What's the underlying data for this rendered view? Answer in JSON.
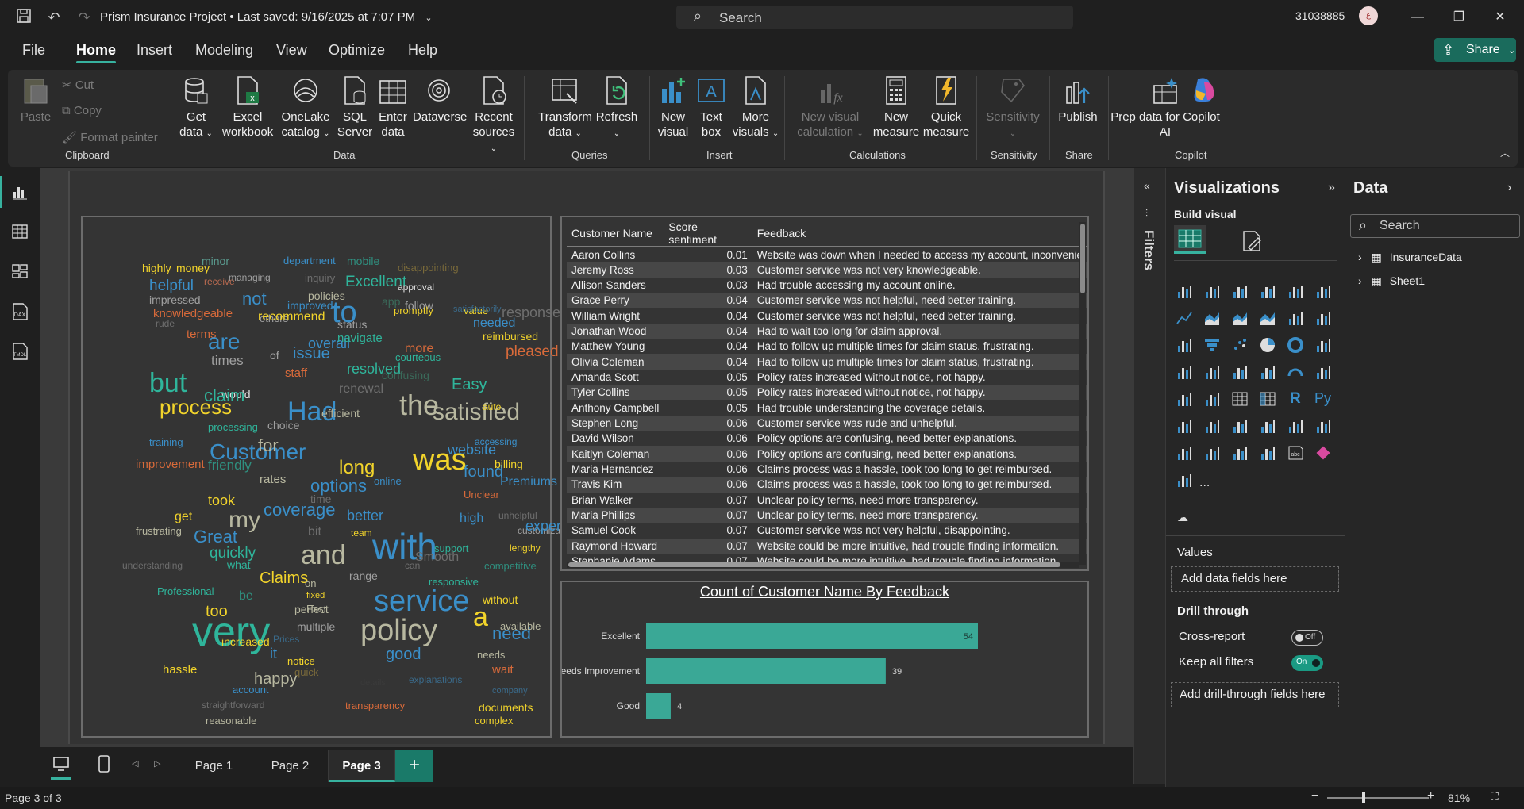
{
  "titlebar": {
    "doc_title": "Prism Insurance Project • Last saved: 9/16/2025 at 7:07 PM",
    "search_placeholder": "Search",
    "user_id": "31038885",
    "avatar_initials": "ع"
  },
  "menu": {
    "tabs": [
      "File",
      "Home",
      "Insert",
      "Modeling",
      "View",
      "Optimize",
      "Help"
    ],
    "active": "Home",
    "share_label": "Share"
  },
  "ribbon": {
    "clipboard": {
      "paste": "Paste",
      "cut": "Cut",
      "copy": "Copy",
      "format_painter": "Format painter",
      "label": "Clipboard"
    },
    "data": {
      "label": "Data",
      "get_data": [
        "Get",
        "data"
      ],
      "excel": [
        "Excel",
        "workbook"
      ],
      "onelake": [
        "OneLake",
        "catalog"
      ],
      "sql": [
        "SQL",
        "Server"
      ],
      "enter_data": [
        "Enter",
        "data"
      ],
      "dataverse": "Dataverse",
      "recent": [
        "Recent",
        "sources"
      ]
    },
    "queries": {
      "label": "Queries",
      "transform": [
        "Transform",
        "data"
      ],
      "refresh": "Refresh"
    },
    "insert": {
      "label": "Insert",
      "new_visual": [
        "New",
        "visual"
      ],
      "text_box": [
        "Text",
        "box"
      ],
      "more_visuals": [
        "More",
        "visuals"
      ]
    },
    "calculations": {
      "label": "Calculations",
      "new_visual_calc": [
        "New visual",
        "calculation"
      ],
      "new_measure": [
        "New",
        "measure"
      ],
      "quick_measure": [
        "Quick",
        "measure"
      ]
    },
    "sensitivity": {
      "label": "Sensitivity",
      "btn": "Sensitivity"
    },
    "share": {
      "label": "Share",
      "publish": "Publish"
    },
    "copilot": {
      "label": "Copilot",
      "prep": [
        "Prep data for Copilot",
        "AI"
      ]
    }
  },
  "wordcloud": {
    "words": [
      {
        "t": "highly",
        "c": "#f2d42b",
        "s": 14
      },
      {
        "t": "money",
        "c": "#f2d42b",
        "s": 14
      },
      {
        "t": "minor",
        "c": "#5a9a8e",
        "s": 14
      },
      {
        "t": "department",
        "c": "#3a8fc9",
        "s": 13
      },
      {
        "t": "mobile",
        "c": "#2f8f7f",
        "s": 14
      },
      {
        "t": "disappointing",
        "c": "#7a6a3a",
        "s": 13
      },
      {
        "t": "helpful",
        "c": "#3a8fc9",
        "s": 19
      },
      {
        "t": "receive",
        "c": "#b86a50",
        "s": 12
      },
      {
        "t": "managing",
        "c": "#a0a0a0",
        "s": 12
      },
      {
        "t": "inquiry",
        "c": "#6e6e6e",
        "s": 13
      },
      {
        "t": "Excellent",
        "c": "#2fb59b",
        "s": 19
      },
      {
        "t": "approval",
        "c": "#e0e0e0",
        "s": 12
      },
      {
        "t": "impressed",
        "c": "#a0a0a0",
        "s": 14
      },
      {
        "t": "not",
        "c": "#3a8fc9",
        "s": 22
      },
      {
        "t": "policies",
        "c": "#b8b8a0",
        "s": 14
      },
      {
        "t": "app",
        "c": "#3a6a5a",
        "s": 14
      },
      {
        "t": "follow",
        "c": "#a0a0a0",
        "s": 14
      },
      {
        "t": "knowledgeable",
        "c": "#d86a3a",
        "s": 15
      },
      {
        "t": "improved",
        "c": "#3a8fc9",
        "s": 14
      },
      {
        "t": "to",
        "c": "#3a8fc9",
        "s": 38
      },
      {
        "t": "value",
        "c": "#f2d42b",
        "s": 13
      },
      {
        "t": "response",
        "c": "#6e6e6e",
        "s": 18
      },
      {
        "t": "promptly",
        "c": "#f2d42b",
        "s": 13
      },
      {
        "t": "rude",
        "c": "#6e6e6e",
        "s": 12
      },
      {
        "t": "others",
        "c": "#a0a0a0",
        "s": 13
      },
      {
        "t": "recommend",
        "c": "#f2d42b",
        "s": 16
      },
      {
        "t": "status",
        "c": "#a0a0a0",
        "s": 14
      },
      {
        "t": "needed",
        "c": "#3a8fc9",
        "s": 16
      },
      {
        "t": "satisfactorily",
        "c": "#3a6a8a",
        "s": 11
      },
      {
        "t": "terms",
        "c": "#d86a3a",
        "s": 15
      },
      {
        "t": "are",
        "c": "#3a8fc9",
        "s": 28
      },
      {
        "t": "overall",
        "c": "#3a8fc9",
        "s": 18
      },
      {
        "t": "navigate",
        "c": "#2fb59b",
        "s": 15
      },
      {
        "t": "reimbursed",
        "c": "#f2d42b",
        "s": 14
      },
      {
        "t": "times",
        "c": "#a0a0a0",
        "s": 17
      },
      {
        "t": "of",
        "c": "#a0a0a0",
        "s": 14
      },
      {
        "t": "issue",
        "c": "#3a8fc9",
        "s": 20
      },
      {
        "t": "courteous",
        "c": "#2fb59b",
        "s": 13
      },
      {
        "t": "pleased",
        "c": "#d86a3a",
        "s": 19
      },
      {
        "t": "but",
        "c": "#2fb59b",
        "s": 34
      },
      {
        "t": "staff",
        "c": "#d86a3a",
        "s": 15
      },
      {
        "t": "resolved",
        "c": "#2fb59b",
        "s": 18
      },
      {
        "t": "confusing",
        "c": "#3a6a5a",
        "s": 14
      },
      {
        "t": "more",
        "c": "#d86a3a",
        "s": 16
      },
      {
        "t": "would",
        "c": "#e0e0e0",
        "s": 14
      },
      {
        "t": "process",
        "c": "#f2d42b",
        "s": 26
      },
      {
        "t": "claim",
        "c": "#2fb59b",
        "s": 22
      },
      {
        "t": "renewal",
        "c": "#6e6e6e",
        "s": 16
      },
      {
        "t": "the",
        "c": "#b8b8a0",
        "s": 36
      },
      {
        "t": "Easy",
        "c": "#2fb59b",
        "s": 20
      },
      {
        "t": "Had",
        "c": "#3a8fc9",
        "s": 34
      },
      {
        "t": "satisfied",
        "c": "#b8b8a0",
        "s": 30
      },
      {
        "t": "efficient",
        "c": "#b8b8a0",
        "s": 14
      },
      {
        "t": "auto",
        "c": "#f2d42b",
        "s": 12
      },
      {
        "t": "choice",
        "c": "#a0a0a0",
        "s": 14
      },
      {
        "t": "processing",
        "c": "#2fb59b",
        "s": 13
      },
      {
        "t": "training",
        "c": "#3a8fc9",
        "s": 13
      },
      {
        "t": "Customer",
        "c": "#3a8fc9",
        "s": 28
      },
      {
        "t": "for",
        "c": "#b8b8a0",
        "s": 22
      },
      {
        "t": "was",
        "c": "#f2d42b",
        "s": 38
      },
      {
        "t": "website",
        "c": "#3a8fc9",
        "s": 18
      },
      {
        "t": "accessing",
        "c": "#3a8fc9",
        "s": 12
      },
      {
        "t": "improvement",
        "c": "#d86a3a",
        "s": 15
      },
      {
        "t": "friendly",
        "c": "#2f8f7f",
        "s": 17
      },
      {
        "t": "long",
        "c": "#f2d42b",
        "s": 24
      },
      {
        "t": "found",
        "c": "#3a8fc9",
        "s": 20
      },
      {
        "t": "billing",
        "c": "#f2d42b",
        "s": 14
      },
      {
        "t": "rates",
        "c": "#b8b8a0",
        "s": 15
      },
      {
        "t": "options",
        "c": "#3a8fc9",
        "s": 22
      },
      {
        "t": "online",
        "c": "#3a8fc9",
        "s": 13
      },
      {
        "t": "Premiums",
        "c": "#3a8fc9",
        "s": 16
      },
      {
        "t": "took",
        "c": "#f2d42b",
        "s": 18
      },
      {
        "t": "time",
        "c": "#6e6e6e",
        "s": 14
      },
      {
        "t": "Unclear",
        "c": "#d86a3a",
        "s": 13
      },
      {
        "t": "get",
        "c": "#f2d42b",
        "s": 16
      },
      {
        "t": "my",
        "c": "#b8b8a0",
        "s": 30
      },
      {
        "t": "coverage",
        "c": "#3a8fc9",
        "s": 22
      },
      {
        "t": "better",
        "c": "#3a8fc9",
        "s": 18
      },
      {
        "t": "high",
        "c": "#3a8fc9",
        "s": 16
      },
      {
        "t": "unhelpful",
        "c": "#6e6e6e",
        "s": 12
      },
      {
        "t": "frustrating",
        "c": "#b8b8a0",
        "s": 13
      },
      {
        "t": "Great",
        "c": "#3a8fc9",
        "s": 22
      },
      {
        "t": "bit",
        "c": "#6e6e6e",
        "s": 16
      },
      {
        "t": "team",
        "c": "#f2d42b",
        "s": 12
      },
      {
        "t": "customization",
        "c": "#a0a0a0",
        "s": 12
      },
      {
        "t": "experience",
        "c": "#3a8fc9",
        "s": 18
      },
      {
        "t": "quickly",
        "c": "#2fb59b",
        "s": 19
      },
      {
        "t": "and",
        "c": "#b8b8a0",
        "s": 34
      },
      {
        "t": "with",
        "c": "#3a8fc9",
        "s": 46
      },
      {
        "t": "support",
        "c": "#2fb59b",
        "s": 13
      },
      {
        "t": "lengthy",
        "c": "#f2d42b",
        "s": 12
      },
      {
        "t": "understanding",
        "c": "#6e6e6e",
        "s": 12
      },
      {
        "t": "what",
        "c": "#2fb59b",
        "s": 14
      },
      {
        "t": "can",
        "c": "#6e6e6e",
        "s": 12
      },
      {
        "t": "Smooth",
        "c": "#6e6e6e",
        "s": 16
      },
      {
        "t": "competitive",
        "c": "#2f8f7f",
        "s": 13
      },
      {
        "t": "Claims",
        "c": "#f2d42b",
        "s": 20
      },
      {
        "t": "range",
        "c": "#a0a0a0",
        "s": 14
      },
      {
        "t": "responsive",
        "c": "#2fb59b",
        "s": 13
      },
      {
        "t": "Professional",
        "c": "#2fb59b",
        "s": 13
      },
      {
        "t": "be",
        "c": "#2f8f7f",
        "s": 16
      },
      {
        "t": "fixed",
        "c": "#f2d42b",
        "s": 11
      },
      {
        "t": "service",
        "c": "#3a8fc9",
        "s": 38
      },
      {
        "t": "on",
        "c": "#b8b8a0",
        "s": 13
      },
      {
        "t": "too",
        "c": "#f2d42b",
        "s": 20
      },
      {
        "t": "perfect",
        "c": "#b8b8a0",
        "s": 14
      },
      {
        "t": "a",
        "c": "#f2d42b",
        "s": 34
      },
      {
        "t": "Fast",
        "c": "#b8b8a0",
        "s": 13
      },
      {
        "t": "without",
        "c": "#f2d42b",
        "s": 14
      },
      {
        "t": "multiple",
        "c": "#a0a0a0",
        "s": 14
      },
      {
        "t": "need",
        "c": "#3a8fc9",
        "s": 22
      },
      {
        "t": "very",
        "c": "#2fb59b",
        "s": 52
      },
      {
        "t": "Prices",
        "c": "#3a6a8a",
        "s": 12
      },
      {
        "t": "available",
        "c": "#b8b8a0",
        "s": 13
      },
      {
        "t": "increased",
        "c": "#f2d42b",
        "s": 14
      },
      {
        "t": "it",
        "c": "#3a8fc9",
        "s": 18
      },
      {
        "t": "policy",
        "c": "#b8b8a0",
        "s": 38
      },
      {
        "t": "needs",
        "c": "#b8b8a0",
        "s": 13
      },
      {
        "t": "hassle",
        "c": "#f2d42b",
        "s": 15
      },
      {
        "t": "notice",
        "c": "#f2d42b",
        "s": 13
      },
      {
        "t": "good",
        "c": "#3a8fc9",
        "s": 20
      },
      {
        "t": "wait",
        "c": "#d86a3a",
        "s": 15
      },
      {
        "t": "happy",
        "c": "#b8b8a0",
        "s": 20
      },
      {
        "t": "quick",
        "c": "#7a6a3a",
        "s": 13
      },
      {
        "t": "details",
        "c": "#3a3a3a",
        "s": 11
      },
      {
        "t": "explanations",
        "c": "#3a6a8a",
        "s": 12
      },
      {
        "t": "straightforward",
        "c": "#6e6e6e",
        "s": 12
      },
      {
        "t": "account",
        "c": "#3a8fc9",
        "s": 13
      },
      {
        "t": "transparency",
        "c": "#d86a3a",
        "s": 13
      },
      {
        "t": "company",
        "c": "#3a6a8a",
        "s": 11
      },
      {
        "t": "documents",
        "c": "#f2d42b",
        "s": 14
      },
      {
        "t": "complex",
        "c": "#f2d42b",
        "s": 13
      },
      {
        "t": "reasonable",
        "c": "#b8b8a0",
        "s": 13
      }
    ]
  },
  "table": {
    "headers": [
      "Customer Name",
      "Score sentiment",
      "Feedback"
    ],
    "rows": [
      [
        "Aaron Collins",
        "0.01",
        "Website was down when I needed to access my account, inconvenie"
      ],
      [
        "Jeremy Ross",
        "0.03",
        "Customer service was not very knowledgeable."
      ],
      [
        "Allison Sanders",
        "0.03",
        "Had trouble accessing my account online."
      ],
      [
        "Grace Perry",
        "0.04",
        "Customer service was not helpful, need better training."
      ],
      [
        "William Wright",
        "0.04",
        "Customer service was not helpful, need better training."
      ],
      [
        "Jonathan Wood",
        "0.04",
        "Had to wait too long for claim approval."
      ],
      [
        "Matthew Young",
        "0.04",
        "Had to follow up multiple times for claim status, frustrating."
      ],
      [
        "Olivia Coleman",
        "0.04",
        "Had to follow up multiple times for claim status, frustrating."
      ],
      [
        "Amanda Scott",
        "0.05",
        "Policy rates increased without notice, not happy."
      ],
      [
        "Tyler Collins",
        "0.05",
        "Policy rates increased without notice, not happy."
      ],
      [
        "Anthony Campbell",
        "0.05",
        "Had trouble understanding the coverage details."
      ],
      [
        "Stephen Long",
        "0.06",
        "Customer service was rude and unhelpful."
      ],
      [
        "David Wilson",
        "0.06",
        "Policy options are confusing, need better explanations."
      ],
      [
        "Kaitlyn Coleman",
        "0.06",
        "Policy options are confusing, need better explanations."
      ],
      [
        "Maria Hernandez",
        "0.06",
        "Claims process was a hassle, took too long to get reimbursed."
      ],
      [
        "Travis Kim",
        "0.06",
        "Claims process was a hassle, took too long to get reimbursed."
      ],
      [
        "Brian Walker",
        "0.07",
        "Unclear policy terms, need more transparency."
      ],
      [
        "Maria Phillips",
        "0.07",
        "Unclear policy terms, need more transparency."
      ],
      [
        "Samuel Cook",
        "0.07",
        "Customer service was not very helpful, disappointing."
      ],
      [
        "Raymond Howard",
        "0.07",
        "Website could be more intuitive, had trouble finding information."
      ],
      [
        "Stephanie Adams",
        "0.07",
        "Website could be more intuitive, had trouble finding information."
      ]
    ]
  },
  "chart_data": {
    "type": "bar",
    "orientation": "horizontal",
    "title": "Count of Customer Name By Feedback",
    "categories": [
      "Excellent",
      "Needs Improvement",
      "Good"
    ],
    "values": [
      54,
      39,
      4
    ],
    "xlim": [
      0,
      54
    ],
    "bar_color": "#3aa896"
  },
  "pages": {
    "tabs": [
      "Page 1",
      "Page 2",
      "Page 3"
    ],
    "active": "Page 3",
    "add_label": "+"
  },
  "status": {
    "page_info": "Page 3 of 3",
    "zoom": "81%"
  },
  "filters": {
    "label": "Filters"
  },
  "visualizations": {
    "title": "Visualizations",
    "build_visual": "Build visual",
    "values_label": "Values",
    "values_drop": "Add data fields here",
    "drill_title": "Drill through",
    "cross_report": "Cross-report",
    "cross_report_state": "Off",
    "keep_filters": "Keep all filters",
    "keep_filters_state": "On",
    "drill_drop": "Add drill-through fields here",
    "more": "..."
  },
  "data_panel": {
    "title": "Data",
    "search_placeholder": "Search",
    "tables": [
      "InsuranceData",
      "Sheet1"
    ]
  },
  "colors": {
    "accent": "#37b29f",
    "share": "#1a6b5c",
    "bar": "#3aa896"
  }
}
